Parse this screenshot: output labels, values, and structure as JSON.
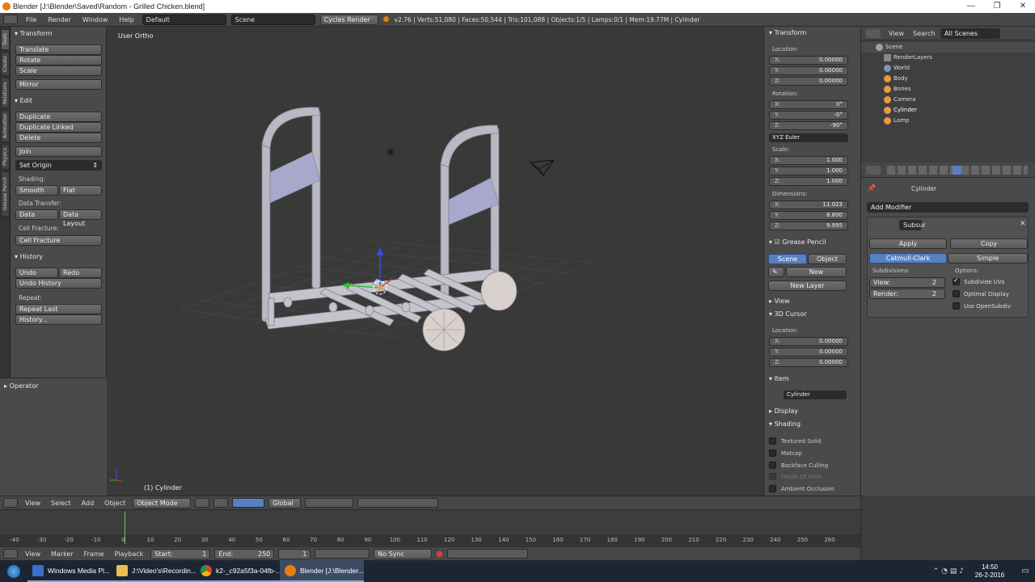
{
  "window": {
    "title": "Blender [J:\\Blender\\Saved\\Random - Grilled Chicken.blend]",
    "minimize": "—",
    "maximize": "❐",
    "close": "✕"
  },
  "infobar": {
    "menus": [
      "File",
      "Render",
      "Window",
      "Help"
    ],
    "layout": "Default",
    "scene": "Scene",
    "engine": "Cycles Render",
    "stats": "v2.76 | Verts:51,080 | Faces:50,544 | Tris:101,088 | Objects:1/5 | Lamps:0/1 | Mem:19.77M | Cylinder"
  },
  "tabs": [
    "Tools",
    "Create",
    "Relations",
    "Animation",
    "Physics",
    "Grease Pencil"
  ],
  "shelf": {
    "transform": {
      "title": "Transform",
      "buttons": [
        "Translate",
        "Rotate",
        "Scale",
        "Mirror"
      ]
    },
    "edit": {
      "title": "Edit",
      "buttons": [
        "Duplicate",
        "Duplicate Linked",
        "Delete",
        "Join"
      ],
      "set_origin": "Set Origin",
      "shading_label": "Shading:",
      "smooth": "Smooth",
      "flat": "Flat",
      "data_transfer_label": "Data Transfer:",
      "data": "Data",
      "data_layout": "Data Layout",
      "cell_fracture_label": "Cell Fracture:",
      "cell_fracture": "Cell Fracture"
    },
    "history": {
      "title": "History",
      "undo": "Undo",
      "redo": "Redo",
      "undo_history": "Undo History",
      "repeat_label": "Repeat:",
      "repeat_last": "Repeat Last",
      "history_btn": "History..."
    }
  },
  "operator": {
    "title": "Operator"
  },
  "viewport": {
    "label": "User Ortho",
    "object_label": "(1) Cylinder"
  },
  "vpheader": {
    "menus": [
      "View",
      "Select",
      "Add",
      "Object"
    ],
    "mode": "Object Mode",
    "orientation": "Global"
  },
  "npanel": {
    "transform_title": "Transform",
    "location_label": "Location:",
    "location": [
      {
        "k": "X:",
        "v": "0.00000"
      },
      {
        "k": "Y:",
        "v": "0.00000"
      },
      {
        "k": "Z:",
        "v": "0.00000"
      }
    ],
    "rotation_label": "Rotation:",
    "rotation": [
      {
        "k": "X:",
        "v": "0°"
      },
      {
        "k": "Y:",
        "v": "-0°"
      },
      {
        "k": "Z:",
        "v": "-90°"
      }
    ],
    "rotation_mode": "XYZ Euler",
    "scale_label": "Scale:",
    "scale": [
      {
        "k": "X:",
        "v": "1.000"
      },
      {
        "k": "Y:",
        "v": "1.000"
      },
      {
        "k": "Z:",
        "v": "1.000"
      }
    ],
    "dimensions_label": "Dimensions:",
    "dimensions": [
      {
        "k": "X:",
        "v": "11.023"
      },
      {
        "k": "Y:",
        "v": "8.800"
      },
      {
        "k": "Z:",
        "v": "9.995"
      }
    ],
    "grease_title": "Grease Pencil",
    "gp_scene": "Scene",
    "gp_object": "Object",
    "gp_new": "New",
    "gp_new_layer": "New Layer",
    "view_title": "View",
    "cursor_title": "3D Cursor",
    "cursor_location_label": "Location:",
    "cursor": [
      {
        "k": "X:",
        "v": "0.00000"
      },
      {
        "k": "Y:",
        "v": "0.00000"
      },
      {
        "k": "Z:",
        "v": "0.00000"
      }
    ],
    "item_title": "Item",
    "item_name": "Cylinder",
    "display_title": "Display",
    "shading_title": "Shading",
    "shading_opts": [
      "Textured Solid",
      "Matcap",
      "Backface Culling",
      "Depth Of Field",
      "Ambient Occlusion"
    ]
  },
  "outliner": {
    "view": "View",
    "search": "Search",
    "filter": "All Scenes",
    "rows": [
      "Scene",
      "RenderLayers",
      "World",
      "Body",
      "Bones",
      "Camera",
      "Cylinder",
      "Lamp"
    ]
  },
  "props": {
    "object": "Cylinder",
    "add_modifier": "Add Modifier",
    "modifier_name": "Subsur",
    "apply": "Apply",
    "copy": "Copy",
    "catmull": "Catmull-Clark",
    "simple": "Simple",
    "subdivisions_label": "Subdivisions:",
    "options_label": "Options:",
    "view_label": "View:",
    "view_val": "2",
    "render_label": "Render:",
    "render_val": "2",
    "opt_uvs": "Subdivide UVs",
    "opt_display": "Optimal Display",
    "opt_opensubdiv": "Use OpenSubdiv"
  },
  "timeline": {
    "ticks": [
      "-40",
      "-30",
      "-20",
      "-10",
      "0",
      "10",
      "20",
      "30",
      "40",
      "50",
      "60",
      "70",
      "80",
      "90",
      "100",
      "110",
      "120",
      "130",
      "140",
      "150",
      "160",
      "170",
      "180",
      "190",
      "200",
      "210",
      "220",
      "230",
      "240",
      "250",
      "260"
    ],
    "menus": [
      "View",
      "Marker",
      "Frame",
      "Playback"
    ],
    "start_label": "Start:",
    "start": "1",
    "end_label": "End:",
    "end": "250",
    "current": "1",
    "sync": "No Sync"
  },
  "taskbar": {
    "items": [
      "Windows Media Pl...",
      "J:\\Video's\\Recordin...",
      "k2-_c92a5f3a-04fb-...",
      "Blender [J:\\Blender..."
    ],
    "time": "14:50",
    "date": "26-2-2016"
  },
  "colors": {
    "accent": "#5680c2",
    "header": "#474747",
    "panel": "#4a4a4a",
    "viewport": "#393939"
  }
}
